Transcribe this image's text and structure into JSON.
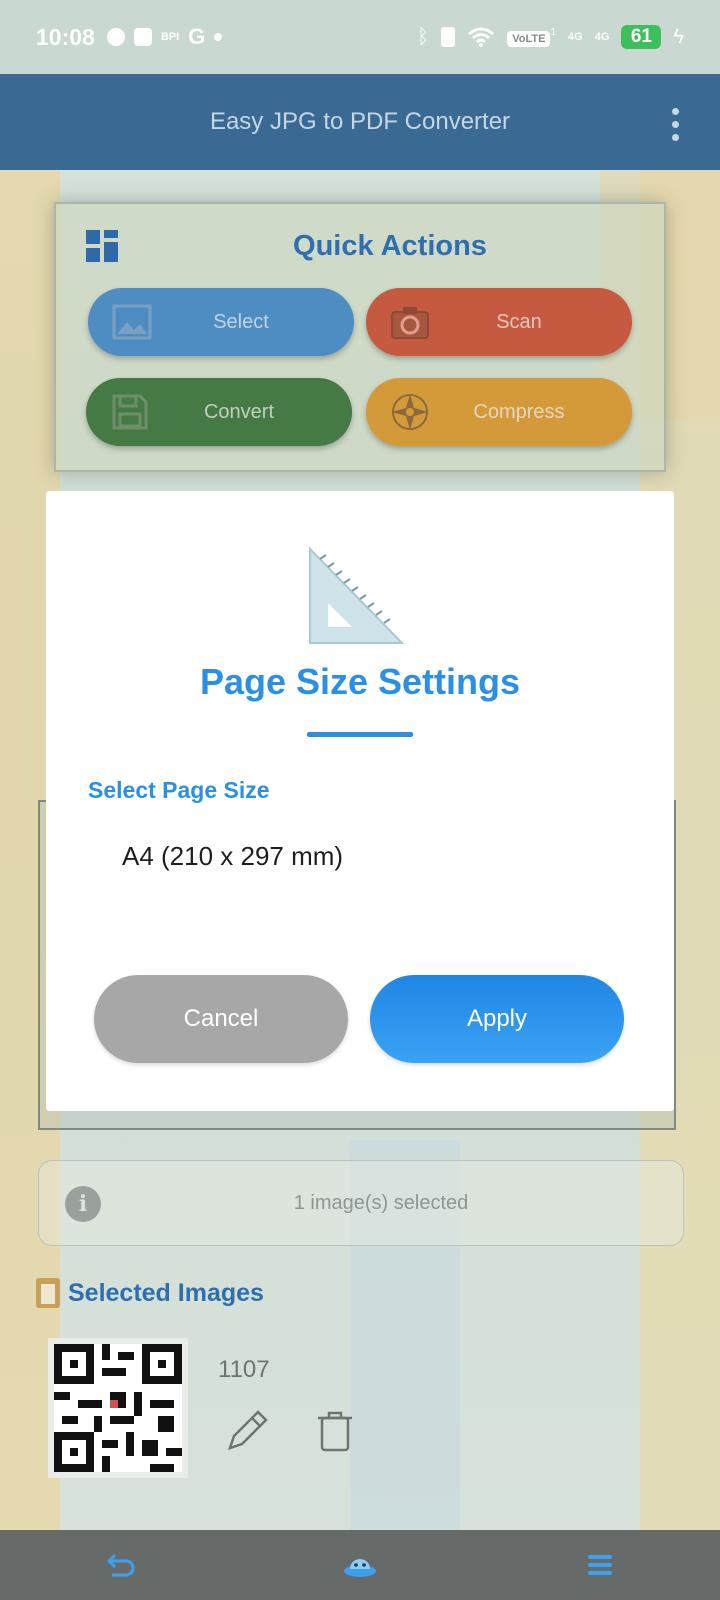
{
  "status_bar": {
    "time": "10:08",
    "left_icon_text": "BPI",
    "volte": "VoLTE",
    "sim1_superscript": "1",
    "network_1": "4G",
    "network_2": "4G",
    "battery": "61"
  },
  "app_bar": {
    "title": "Easy JPG to PDF Converter",
    "menu_icon": "more-vert-icon"
  },
  "quick_actions": {
    "title": "Quick Actions",
    "buttons": [
      {
        "label": "Select",
        "icon": "image-icon",
        "color": "#4d8dc2"
      },
      {
        "label": "Scan",
        "icon": "camera-icon",
        "color": "#c55a40"
      },
      {
        "label": "Convert",
        "icon": "save-icon",
        "color": "#467a45"
      },
      {
        "label": "Compress",
        "icon": "compass-icon",
        "color": "#d49a3a"
      }
    ]
  },
  "info": {
    "text": "1 image(s) selected"
  },
  "selected_images": {
    "title": "Selected Images",
    "items": [
      {
        "name": "1107"
      }
    ]
  },
  "dialog": {
    "title": "Page Size Settings",
    "section_label": "Select Page Size",
    "selected_value": "A4 (210 x 297 mm)",
    "cancel_label": "Cancel",
    "apply_label": "Apply",
    "accent_color": "#2b8fe6"
  },
  "nav_bar": {
    "icons": [
      "back-icon",
      "assistant-icon",
      "menu-icon"
    ]
  }
}
